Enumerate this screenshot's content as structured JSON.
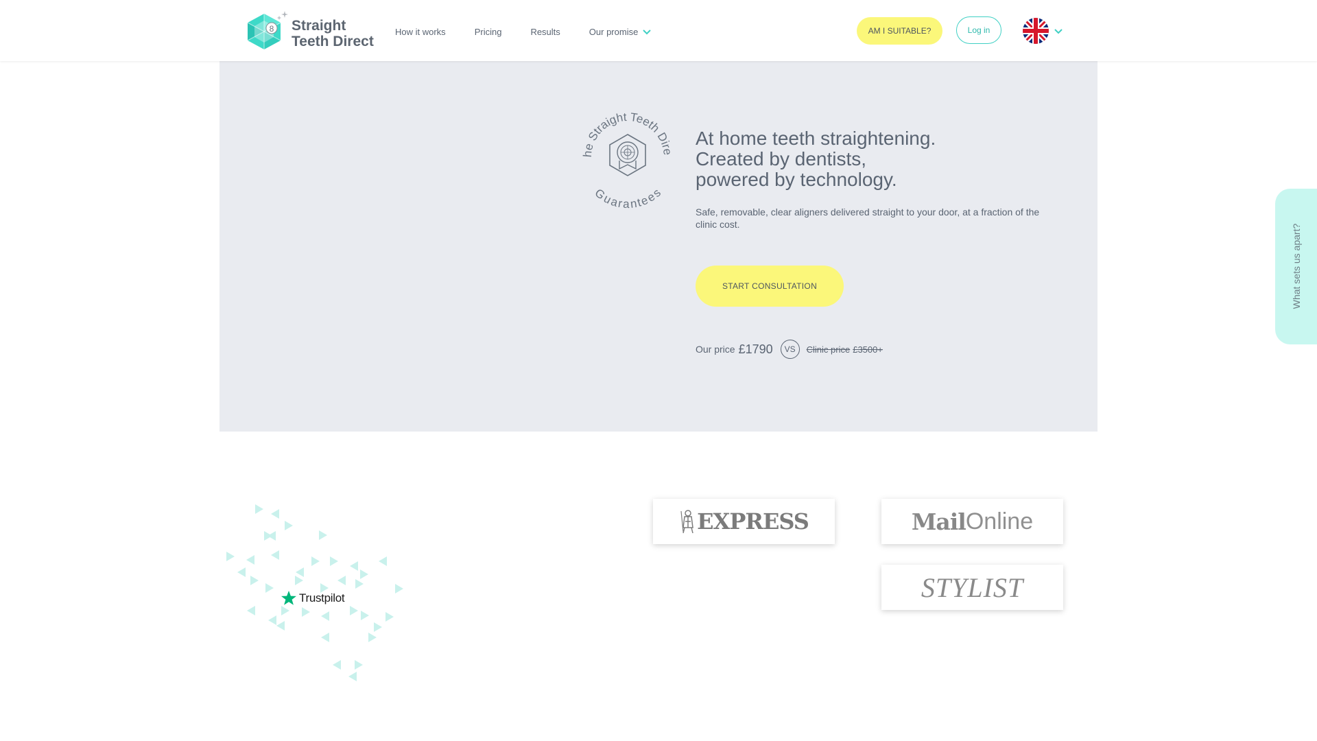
{
  "header": {
    "logo": {
      "line1": "Straight",
      "line2": "Teeth Direct",
      "badge_number": "8"
    },
    "nav": [
      {
        "label": "How it works"
      },
      {
        "label": "Pricing"
      },
      {
        "label": "Results"
      },
      {
        "label": "Our promise",
        "icon": "chevron-down-icon"
      }
    ],
    "suitable_label": "AM I SUITABLE?",
    "login_label": "Log in",
    "language": {
      "flag": "uk-flag-icon",
      "icon": "chevron-down-icon"
    }
  },
  "hero": {
    "badge": {
      "top_text": "The Straight Teeth Direct",
      "bottom_text": "Guarantees"
    },
    "title_lines": [
      "At home teeth straightening.",
      "Created by dentists,",
      "powered by technology."
    ],
    "subtitle": "Safe, removable, clear aligners delivered straight to your door, at a fraction of the clinic cost.",
    "cta_label": "START CONSULTATION",
    "price": {
      "our_label": "Our price",
      "our_value": "£1790",
      "vs_label": "VS",
      "clinic_label": "Clinic price",
      "clinic_value": "£3500+"
    }
  },
  "side_tab": {
    "label": "What sets us apart?"
  },
  "press": {
    "express": "EXPRESS",
    "mail_bold": "Mail",
    "mail_light": "Online",
    "stylist": "STYLIST"
  },
  "trustpilot": {
    "label": "Trustpilot"
  },
  "colors": {
    "accent_yellow": "#fbf77a",
    "accent_teal": "#3fd0c4",
    "hero_bg": "#e9ebf0",
    "text": "#5a6472",
    "trustpilot_green": "#00b67a"
  }
}
